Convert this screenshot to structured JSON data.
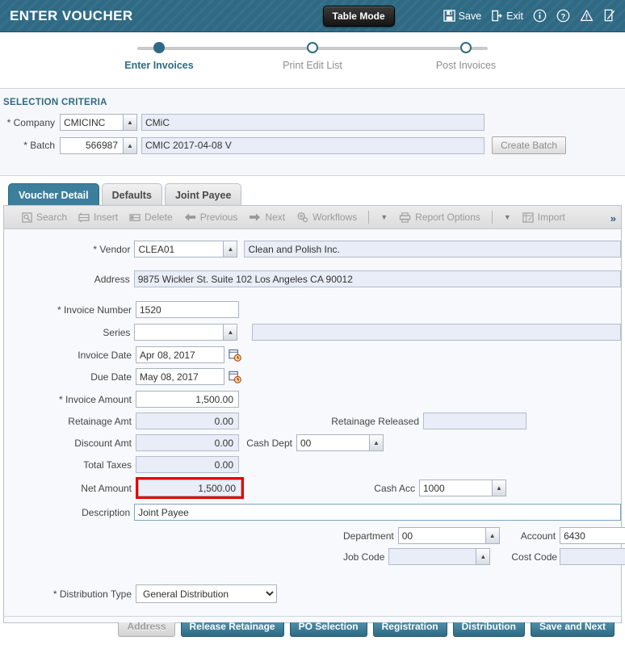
{
  "header": {
    "title": "ENTER VOUCHER",
    "table_mode_label": "Table Mode",
    "save_label": "Save",
    "exit_label": "Exit",
    "info_icon": "info-icon",
    "help_icon": "help-icon",
    "warning_icon": "warning-icon",
    "notes_icon": "notes-edit-icon",
    "accent_color": "#2e6a84"
  },
  "wizard": {
    "steps": [
      {
        "label": "Enter Invoices",
        "active": true
      },
      {
        "label": "Print Edit List",
        "active": false
      },
      {
        "label": "Post Invoices",
        "active": false
      }
    ]
  },
  "criteria": {
    "title": "SELECTION CRITERIA",
    "company_label": "* Company",
    "company_code": "CMICINC",
    "company_name": "CMiC",
    "batch_label": "* Batch",
    "batch_number": "566987",
    "batch_description": "CMIC 2017-04-08 V",
    "create_batch_label": "Create Batch"
  },
  "tabs": [
    {
      "label": "Voucher Detail",
      "active": true
    },
    {
      "label": "Defaults",
      "active": false
    },
    {
      "label": "Joint Payee",
      "active": false
    }
  ],
  "toolbar": {
    "items": [
      {
        "label": "Search",
        "icon": "search-icon"
      },
      {
        "label": "Insert",
        "icon": "insert-row-icon"
      },
      {
        "label": "Delete",
        "icon": "delete-row-icon"
      },
      {
        "label": "Previous",
        "icon": "arrow-left-icon"
      },
      {
        "label": "Next",
        "icon": "arrow-right-icon"
      },
      {
        "label": "Workflows",
        "icon": "gears-icon"
      },
      {
        "label": "Report Options",
        "icon": "printer-icon"
      },
      {
        "label": "Import",
        "icon": "import-grid-icon"
      }
    ],
    "overflow_label": "»"
  },
  "form": {
    "vendor_label": "* Vendor",
    "vendor_code": "CLEA01",
    "vendor_name": "Clean and Polish Inc.",
    "address_label": "Address",
    "address_value": "9875 Wickler St. Suite 102 Los Angeles CA 90012",
    "invoice_number_label": "* Invoice Number",
    "invoice_number_value": "1520",
    "series_label": "Series",
    "series_value": "",
    "series_desc": "",
    "invoice_date_label": "Invoice Date",
    "invoice_date_value": "Apr 08, 2017",
    "due_date_label": "Due Date",
    "due_date_value": "May 08, 2017",
    "invoice_amount_label": "* Invoice Amount",
    "invoice_amount_value": "1,500.00",
    "retainage_amt_label": "Retainage Amt",
    "retainage_amt_value": "0.00",
    "retainage_released_label": "Retainage Released",
    "retainage_released_value": "",
    "discount_amt_label": "Discount Amt",
    "discount_amt_value": "0.00",
    "cash_dept_label": "Cash Dept",
    "cash_dept_value": "00",
    "total_taxes_label": "Total Taxes",
    "total_taxes_value": "0.00",
    "net_amount_label": "Net Amount",
    "net_amount_value": "1,500.00",
    "net_amount_highlight_color": "#e60000",
    "cash_acc_label": "Cash Acc",
    "cash_acc_value": "1000",
    "description_label": "Description",
    "description_value": "Joint Payee",
    "department_label": "Department",
    "department_value": "00",
    "account_label": "Account",
    "account_value": "6430",
    "job_code_label": "Job Code",
    "job_code_value": "",
    "cost_code_label": "Cost Code",
    "cost_code_value": "",
    "distribution_type_label": "* Distribution Type",
    "distribution_type_value": "General Distribution",
    "distribution_type_options": [
      "General Distribution"
    ],
    "calendar_icon": "calendar-picker-icon"
  },
  "actions": [
    {
      "label": "Address",
      "disabled": true
    },
    {
      "label": "Release Retainage",
      "disabled": false
    },
    {
      "label": "PO Selection",
      "disabled": false
    },
    {
      "label": "Registration",
      "disabled": false
    },
    {
      "label": "Distribution",
      "disabled": false
    },
    {
      "label": "Save and Next",
      "disabled": false
    }
  ]
}
